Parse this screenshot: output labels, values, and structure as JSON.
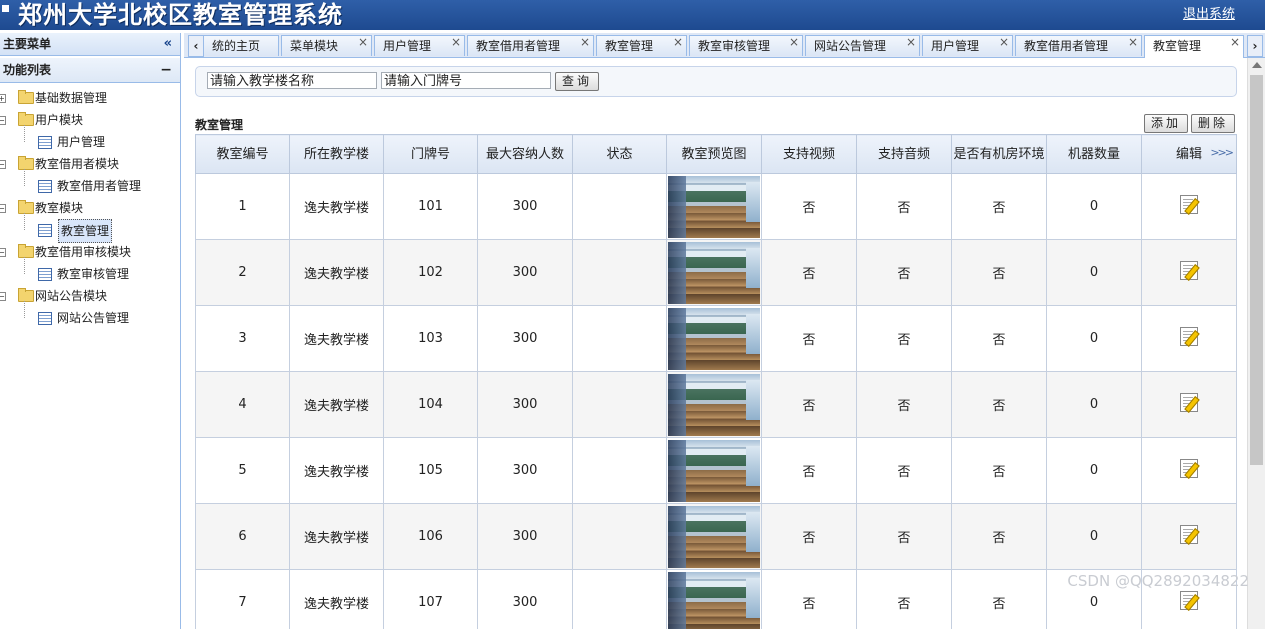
{
  "header": {
    "title": "郑州大学北校区教室管理系统",
    "logout": "退出系统"
  },
  "sidebar": {
    "main_menu": "主要菜单",
    "collapse_icon": "«",
    "function_list": "功能列表",
    "minimize_icon": "−",
    "tree": [
      {
        "label": "基础数据管理",
        "type": "folder",
        "pm": "+"
      },
      {
        "label": "用户模块",
        "type": "folder",
        "pm": "−"
      },
      {
        "label": "用户管理",
        "type": "leaf"
      },
      {
        "label": "教室借用者模块",
        "type": "folder",
        "pm": "−"
      },
      {
        "label": "教室借用者管理",
        "type": "leaf"
      },
      {
        "label": "教室模块",
        "type": "folder",
        "pm": "−"
      },
      {
        "label": "教室管理",
        "type": "leaf",
        "selected": true
      },
      {
        "label": "教室借用审核模块",
        "type": "folder",
        "pm": "−"
      },
      {
        "label": "教室审核管理",
        "type": "leaf"
      },
      {
        "label": "网站公告模块",
        "type": "folder",
        "pm": "−"
      },
      {
        "label": "网站公告管理",
        "type": "leaf"
      }
    ]
  },
  "tabs": [
    {
      "label": "统的主页",
      "closable": false
    },
    {
      "label": "菜单模块",
      "closable": true
    },
    {
      "label": "用户管理",
      "closable": true
    },
    {
      "label": "教室借用者管理",
      "closable": true
    },
    {
      "label": "教室管理",
      "closable": true
    },
    {
      "label": "教室审核管理",
      "closable": true
    },
    {
      "label": "网站公告管理",
      "closable": true
    },
    {
      "label": "用户管理",
      "closable": true
    },
    {
      "label": "教室借用者管理",
      "closable": true
    },
    {
      "label": "教室管理",
      "closable": true,
      "active": true
    }
  ],
  "search": {
    "building_placeholder": "请输入教学楼名称",
    "door_placeholder": "请输入门牌号",
    "query_button": "查询"
  },
  "grid": {
    "title": "教室管理",
    "add_button": "添加",
    "delete_button": "删除",
    "columns": [
      "教室编号",
      "所在教学楼",
      "门牌号",
      "最大容纳人数",
      "状态",
      "教室预览图",
      "支持视频",
      "支持音频",
      "是否有机房环境",
      "机器数量",
      "编辑"
    ],
    "more_icon": ">>>",
    "rows": [
      {
        "id": "1",
        "building": "逸夫教学楼",
        "door": "101",
        "capacity": "300",
        "status": "",
        "video": "否",
        "audio": "否",
        "lab": "否",
        "machines": "0"
      },
      {
        "id": "2",
        "building": "逸夫教学楼",
        "door": "102",
        "capacity": "300",
        "status": "",
        "video": "否",
        "audio": "否",
        "lab": "否",
        "machines": "0"
      },
      {
        "id": "3",
        "building": "逸夫教学楼",
        "door": "103",
        "capacity": "300",
        "status": "",
        "video": "否",
        "audio": "否",
        "lab": "否",
        "machines": "0"
      },
      {
        "id": "4",
        "building": "逸夫教学楼",
        "door": "104",
        "capacity": "300",
        "status": "",
        "video": "否",
        "audio": "否",
        "lab": "否",
        "machines": "0"
      },
      {
        "id": "5",
        "building": "逸夫教学楼",
        "door": "105",
        "capacity": "300",
        "status": "",
        "video": "否",
        "audio": "否",
        "lab": "否",
        "machines": "0"
      },
      {
        "id": "6",
        "building": "逸夫教学楼",
        "door": "106",
        "capacity": "300",
        "status": "",
        "video": "否",
        "audio": "否",
        "lab": "否",
        "machines": "0"
      },
      {
        "id": "7",
        "building": "逸夫教学楼",
        "door": "107",
        "capacity": "300",
        "status": "",
        "video": "否",
        "audio": "否",
        "lab": "否",
        "machines": "0"
      }
    ]
  },
  "watermark": "CSDN @QQ2892034822",
  "colors": {
    "header": "#1e4a90",
    "border": "#99bbe8",
    "grid_header": "#dbe5f3"
  }
}
